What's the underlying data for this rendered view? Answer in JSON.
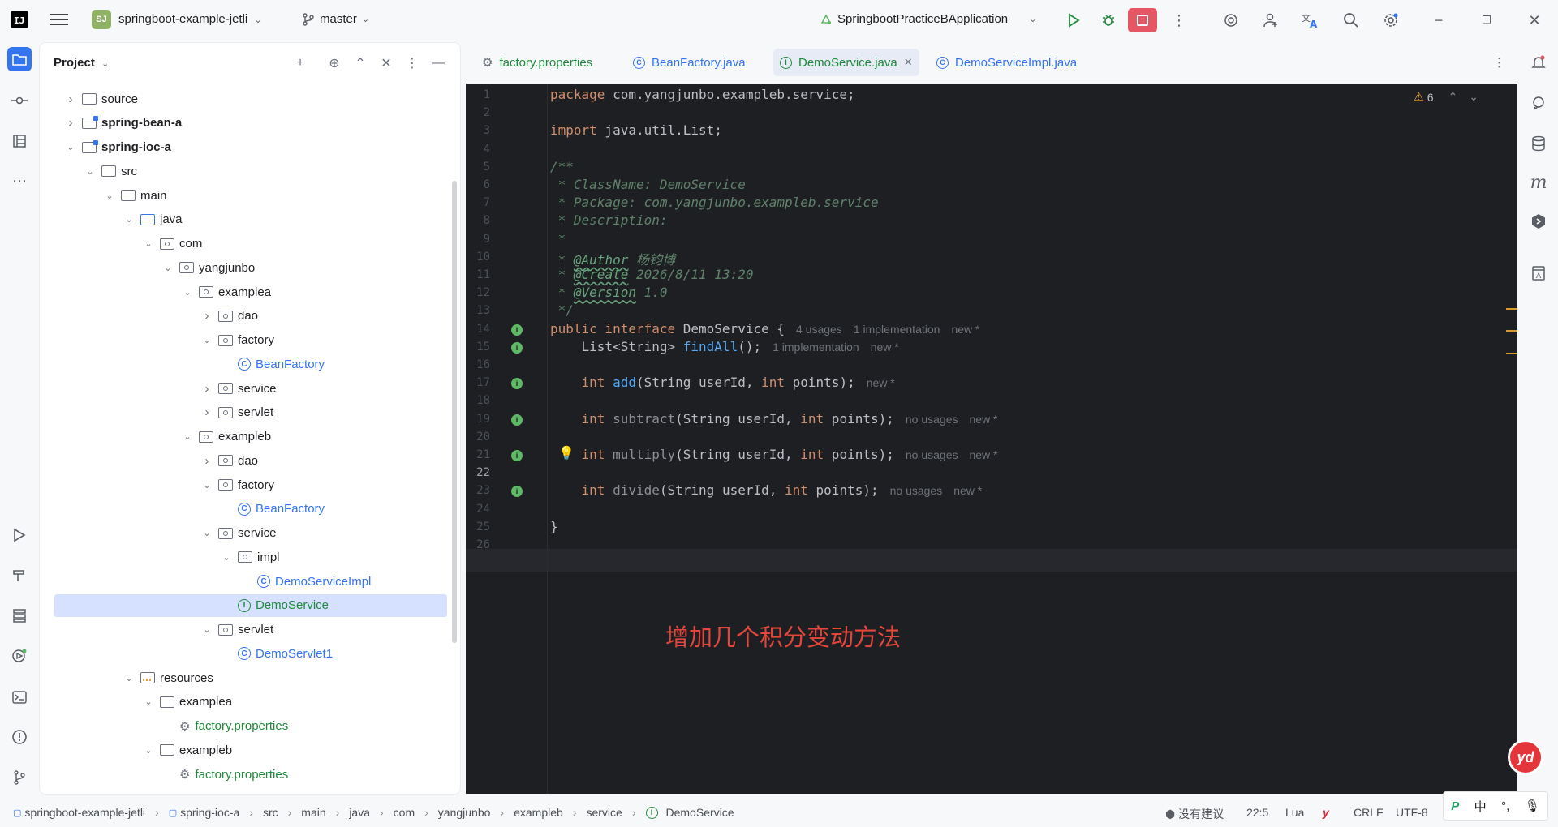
{
  "titlebar": {
    "logo": "IJ",
    "project_badge": "SJ",
    "project_name": "springboot-example-jetli",
    "branch": "master",
    "run_config": "SpringbootPracticeBApplication"
  },
  "project_panel": {
    "title": "Project",
    "tree": [
      {
        "label": "source",
        "type": "folder",
        "depth": 0,
        "state": "collapsed"
      },
      {
        "label": "spring-bean-a",
        "type": "module",
        "depth": 0,
        "state": "collapsed",
        "bold": true
      },
      {
        "label": "spring-ioc-a",
        "type": "module",
        "depth": 0,
        "state": "expanded",
        "bold": true
      },
      {
        "label": "src",
        "type": "folder",
        "depth": 1,
        "state": "expanded"
      },
      {
        "label": "main",
        "type": "folder",
        "depth": 2,
        "state": "expanded"
      },
      {
        "label": "java",
        "type": "source-folder",
        "depth": 3,
        "state": "expanded"
      },
      {
        "label": "com",
        "type": "package",
        "depth": 4,
        "state": "expanded"
      },
      {
        "label": "yangjunbo",
        "type": "package",
        "depth": 5,
        "state": "expanded"
      },
      {
        "label": "examplea",
        "type": "package",
        "depth": 6,
        "state": "expanded"
      },
      {
        "label": "dao",
        "type": "package",
        "depth": 7,
        "state": "collapsed"
      },
      {
        "label": "factory",
        "type": "package",
        "depth": 7,
        "state": "expanded"
      },
      {
        "label": "BeanFactory",
        "type": "class",
        "depth": 8,
        "state": "leaf"
      },
      {
        "label": "service",
        "type": "package",
        "depth": 7,
        "state": "collapsed"
      },
      {
        "label": "servlet",
        "type": "package",
        "depth": 7,
        "state": "collapsed"
      },
      {
        "label": "exampleb",
        "type": "package",
        "depth": 6,
        "state": "expanded"
      },
      {
        "label": "dao",
        "type": "package",
        "depth": 7,
        "state": "collapsed"
      },
      {
        "label": "factory",
        "type": "package",
        "depth": 7,
        "state": "expanded"
      },
      {
        "label": "BeanFactory",
        "type": "class",
        "depth": 8,
        "state": "leaf"
      },
      {
        "label": "service",
        "type": "package",
        "depth": 7,
        "state": "expanded"
      },
      {
        "label": "impl",
        "type": "package",
        "depth": 8,
        "state": "expanded"
      },
      {
        "label": "DemoServiceImpl",
        "type": "class",
        "depth": 9,
        "state": "leaf"
      },
      {
        "label": "DemoService",
        "type": "interface",
        "depth": 8,
        "state": "leaf",
        "selected": true
      },
      {
        "label": "servlet",
        "type": "package",
        "depth": 7,
        "state": "expanded"
      },
      {
        "label": "DemoServlet1",
        "type": "class",
        "depth": 8,
        "state": "leaf"
      },
      {
        "label": "resources",
        "type": "resources",
        "depth": 3,
        "state": "expanded"
      },
      {
        "label": "examplea",
        "type": "folder",
        "depth": 4,
        "state": "expanded"
      },
      {
        "label": "factory.properties",
        "type": "properties",
        "depth": 5,
        "state": "leaf"
      },
      {
        "label": "exampleb",
        "type": "folder",
        "depth": 4,
        "state": "expanded"
      },
      {
        "label": "factory.properties",
        "type": "properties",
        "depth": 5,
        "state": "leaf"
      }
    ]
  },
  "tabs": [
    {
      "label": "factory.properties",
      "icon": "gear-icon",
      "active": false
    },
    {
      "label": "BeanFactory.java",
      "icon": "class-icon",
      "active": false
    },
    {
      "label": "DemoService.java",
      "icon": "interface-icon",
      "active": true
    },
    {
      "label": "DemoServiceImpl.java",
      "icon": "class-icon",
      "active": false
    }
  ],
  "editor": {
    "warning_count": "6",
    "current_line": 22,
    "annotation": "增加几个积分变动方法",
    "lines": [
      {
        "n": "1",
        "html": "<span class=\"kw\">package</span> com.yangjunbo.exampleb.service;"
      },
      {
        "n": "2",
        "html": ""
      },
      {
        "n": "3",
        "html": "<span class=\"kw\">import</span> java.util.List;"
      },
      {
        "n": "4",
        "html": ""
      },
      {
        "n": "5",
        "html": "<span class=\"cmt\">/**</span>"
      },
      {
        "n": "6",
        "html": "<span class=\"cmt\"> * ClassName: DemoService</span>"
      },
      {
        "n": "7",
        "html": "<span class=\"cmt\"> * Package: com.yangjunbo.exampleb.service</span>"
      },
      {
        "n": "8",
        "html": "<span class=\"cmt\"> * Description:</span>"
      },
      {
        "n": "9",
        "html": "<span class=\"cmt\"> *</span>"
      },
      {
        "n": "10",
        "html": "<span class=\"cmt\"> * </span><span class=\"tag\">@Author</span><span class=\"cmt\"> 杨钧博</span>"
      },
      {
        "n": "11",
        "html": "<span class=\"cmt\"> * </span><span class=\"tag\">@Create</span><span class=\"cmt\"> 2026/8/11 13:20</span>"
      },
      {
        "n": "12",
        "html": "<span class=\"cmt\"> * </span><span class=\"tag\">@Version</span><span class=\"cmt\"> 1.0</span>"
      },
      {
        "n": "13",
        "html": "<span class=\"cmt\"> */</span>"
      },
      {
        "n": "14",
        "html": "<span class=\"kw\">public interface</span> DemoService {<span class=\"hint\">4 usages</span><span class=\"hint\">1 implementation</span><span class=\"hint\">new *</span>"
      },
      {
        "n": "15",
        "html": "    List&lt;String&gt; <span class=\"fn\">findAll</span>();<span class=\"hint\">1 implementation</span><span class=\"hint\">new *</span>"
      },
      {
        "n": "16",
        "html": ""
      },
      {
        "n": "17",
        "html": "    <span class=\"kw\">int</span> <span class=\"fn\">add</span>(String userId, <span class=\"kw\">int</span> points);<span class=\"hint\">new *</span>"
      },
      {
        "n": "18",
        "html": ""
      },
      {
        "n": "19",
        "html": "    <span class=\"kw\">int</span> <span style=\"color:#8c8f96\">subtract</span>(String userId, <span class=\"kw\">int</span> points);<span class=\"hint\">no usages</span><span class=\"hint\">new *</span>"
      },
      {
        "n": "20",
        "html": ""
      },
      {
        "n": "21",
        "html": "    <span class=\"kw\">int</span> <span style=\"color:#8c8f96\">multiply</span>(String userId, <span class=\"kw\">int</span> points);<span class=\"hint\">no usages</span><span class=\"hint\">new *</span>"
      },
      {
        "n": "22",
        "html": ""
      },
      {
        "n": "23",
        "html": "    <span class=\"kw\">int</span> <span style=\"color:#8c8f96\">divide</span>(String userId, <span class=\"kw\">int</span> points);<span class=\"hint\">no usages</span><span class=\"hint\">new *</span>"
      },
      {
        "n": "24",
        "html": ""
      },
      {
        "n": "25",
        "html": "}"
      },
      {
        "n": "26",
        "html": ""
      }
    ],
    "gutter_icon_lines": [
      14,
      15,
      17,
      19,
      21,
      23
    ],
    "bulb_line": 21
  },
  "statusbar": {
    "breadcrumbs": [
      "springboot-example-jetli",
      "spring-ioc-a",
      "src",
      "main",
      "java",
      "com",
      "yangjunbo",
      "exampleb",
      "service",
      "DemoService"
    ],
    "suggestion": "没有建议",
    "position": "22:5",
    "language": "Lua",
    "line_sep": "CRLF",
    "encoding": "UTF-8"
  },
  "ime": {
    "mode": "中",
    "punct": "°,"
  },
  "youdao_badge": "yd",
  "colors": {
    "accent": "#3574f0",
    "stop": "#e55765",
    "interface": "#208a3c",
    "annotation": "#e4463b"
  }
}
